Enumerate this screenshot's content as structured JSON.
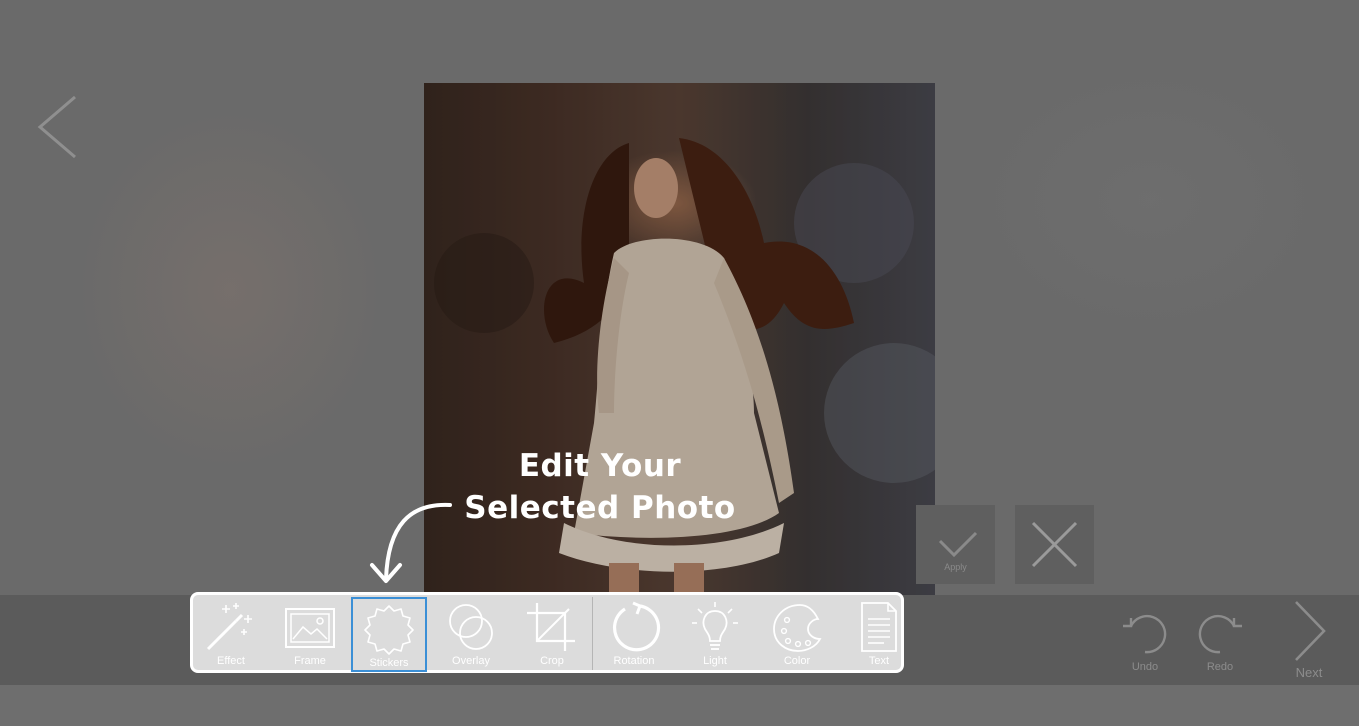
{
  "callout": {
    "line1": "Edit Your",
    "line2": "Selected Photo"
  },
  "apply": {
    "label": "Apply",
    "icon": "check-icon"
  },
  "close": {
    "icon": "close-icon"
  },
  "tools": [
    {
      "label": "Effect",
      "icon": "magic-wand-icon"
    },
    {
      "label": "Frame",
      "icon": "frame-icon"
    },
    {
      "label": "Stickers",
      "icon": "sticker-badge-icon",
      "selected": true
    },
    {
      "label": "Overlay",
      "icon": "overlay-circles-icon"
    },
    {
      "label": "Crop",
      "icon": "crop-icon"
    },
    {
      "label": "Rotation",
      "icon": "rotate-icon"
    },
    {
      "label": "Light",
      "icon": "lightbulb-icon"
    },
    {
      "label": "Color",
      "icon": "palette-icon"
    },
    {
      "label": "Text",
      "icon": "document-text-icon"
    }
  ],
  "history": {
    "undo_label": "Undo",
    "redo_label": "Redo"
  },
  "next": {
    "label": "Next"
  },
  "colors": {
    "selected_border": "#3b8fd6",
    "panel_border": "#ffffff",
    "overlay_gray": "#6e6e6e"
  }
}
